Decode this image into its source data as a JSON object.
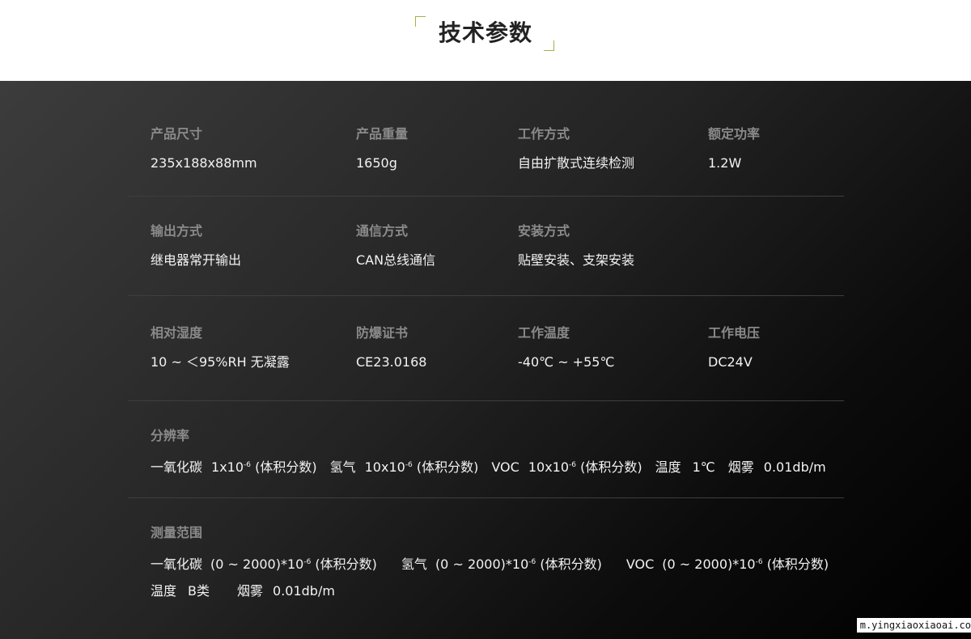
{
  "header": {
    "title": "技术参数"
  },
  "specs": {
    "size": {
      "label": "产品尺寸",
      "value": "235x188x88mm"
    },
    "weight": {
      "label": "产品重量",
      "value": "1650g"
    },
    "mode": {
      "label": "工作方式",
      "value": "自由扩散式连续检测"
    },
    "power": {
      "label": "额定功率",
      "value": "1.2W"
    },
    "output": {
      "label": "输出方式",
      "value": "继电器常开输出"
    },
    "comm": {
      "label": "通信方式",
      "value": "CAN总线通信"
    },
    "install": {
      "label": "安装方式",
      "value": "贴壁安装、支架安装"
    },
    "humidity": {
      "label": "相对湿度",
      "value": "10 ~ ＜95%RH 无凝露"
    },
    "cert": {
      "label": "防爆证书",
      "value": "CE23.0168"
    },
    "temp": {
      "label": "工作温度",
      "value": "-40℃ ~ +55℃"
    },
    "voltage": {
      "label": "工作电压",
      "value": "DC24V"
    }
  },
  "resolution": {
    "label": "分辨率",
    "co": {
      "name": "一氧化碳",
      "base": "1x10",
      "exp": "-6",
      "unit": "(体积分数)"
    },
    "h2": {
      "name": "氢气",
      "base": "10x10",
      "exp": "-6",
      "unit": "(体积分数)"
    },
    "voc": {
      "name": "VOC",
      "base": "10x10",
      "exp": "-6",
      "unit": "(体积分数)"
    },
    "temp": {
      "name": "温度",
      "value": "1℃"
    },
    "smoke": {
      "name": "烟雾",
      "value": "0.01db/m"
    }
  },
  "range": {
    "label": "测量范围",
    "co": {
      "name": "一氧化碳",
      "base": "(0 ~ 2000)*10",
      "exp": "-6",
      "unit": "(体积分数)"
    },
    "h2": {
      "name": "氢气",
      "base": "(0 ~ 2000)*10",
      "exp": "-6",
      "unit": "(体积分数)"
    },
    "voc": {
      "name": "VOC",
      "base": "(0 ~ 2000)*10",
      "exp": "-6",
      "unit": "(体积分数)"
    },
    "temp": {
      "name": "温度",
      "value": "B类"
    },
    "smoke": {
      "name": "烟雾",
      "value": "0.01db/m"
    }
  },
  "watermark": "m.yingxiaoxiaoai.co"
}
